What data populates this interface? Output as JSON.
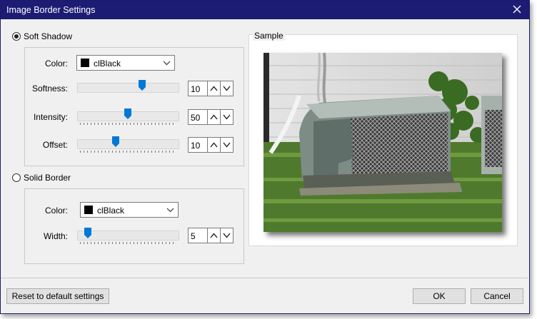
{
  "window": {
    "title": "Image Border Settings"
  },
  "soft_shadow": {
    "label": "Soft Shadow",
    "selected": true,
    "color_label": "Color:",
    "color_value": "clBlack",
    "softness_label": "Softness:",
    "softness_value": "10",
    "intensity_label": "Intensity:",
    "intensity_value": "50",
    "offset_label": "Offset:",
    "offset_value": "10"
  },
  "solid_border": {
    "label": "Solid Border",
    "selected": false,
    "color_label": "Color:",
    "color_value": "clBlack",
    "width_label": "Width:",
    "width_value": "5"
  },
  "sample": {
    "label": "Sample"
  },
  "footer": {
    "reset_label": "Reset to default settings",
    "ok_label": "OK",
    "cancel_label": "Cancel"
  },
  "colors": {
    "titlebar": "#1c1c74",
    "accent": "#0078d7"
  }
}
